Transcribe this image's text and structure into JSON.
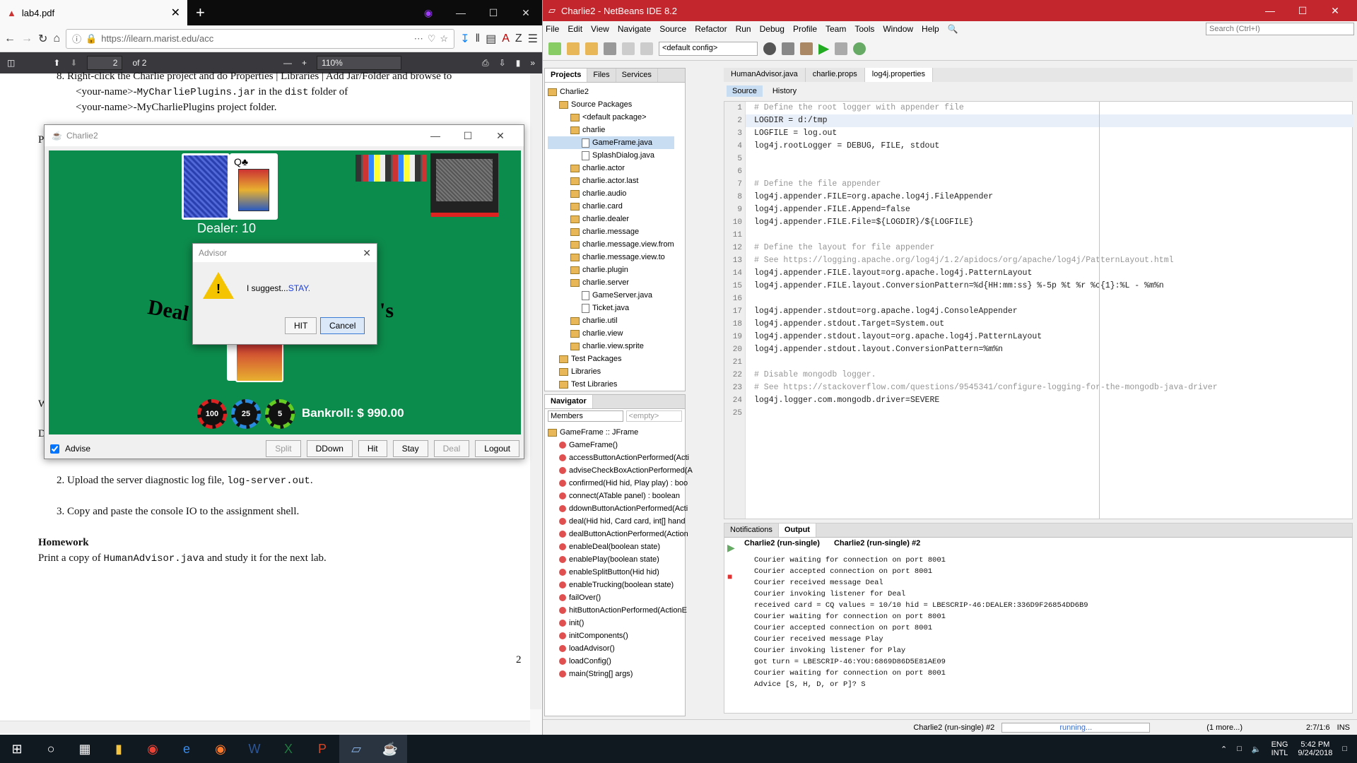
{
  "firefox": {
    "tab_title": "lab4.pdf",
    "url": "https://ilearn.marist.edu/acc",
    "page_current": "2",
    "page_total": "of 2",
    "zoom": "110%",
    "pdf": {
      "step8_line1": "8.   Right-click the Charlie project and do Properties | Libraries | Add Jar/Folder and browse to",
      "step8_line2a": "<your-name>-",
      "step8_line2b": "MyCharliePlugins.jar",
      "step8_line2c": " in the ",
      "step8_line2d": "dist",
      "step8_line2e": " folder of",
      "step8_line3": "<your-name>-MyCharliePlugins project folder.",
      "step2a": "2.   Upload the server diagnostic log file, ",
      "step2b": "log-server.out",
      "step2c": ".",
      "step3": "3.   Copy and paste the console IO to the assignment shell.",
      "homework_heading": "Homework",
      "homework_a": "Print a copy of ",
      "homework_b": "HumanAdvisor.java",
      "homework_c": " and study it for the next lab.",
      "page_number": "2",
      "cutoff_p": "P",
      "cutoff_w": "W",
      "cutoff_d": "D"
    }
  },
  "charlie": {
    "title": "Charlie2",
    "dealer_label": "Dealer: 10",
    "bankroll_label": "Bankroll:  $  990.00",
    "chips": [
      "100",
      "25",
      "5"
    ],
    "banner_left": "Deal",
    "banner_right": "'s",
    "advise_label": "Advise",
    "buttons": {
      "split": "Split",
      "ddown": "DDown",
      "hit": "Hit",
      "stay": "Stay",
      "deal": "Deal",
      "logout": "Logout"
    }
  },
  "advisor": {
    "title": "Advisor",
    "message": "I suggest...",
    "suggestion": "STAY.",
    "hit_label": "HIT",
    "cancel_label": "Cancel"
  },
  "netbeans": {
    "title": "Charlie2 - NetBeans IDE 8.2",
    "menu": [
      "File",
      "Edit",
      "View",
      "Navigate",
      "Source",
      "Refactor",
      "Run",
      "Debug",
      "Profile",
      "Team",
      "Tools",
      "Window",
      "Help"
    ],
    "search_placeholder": "Search (Ctrl+I)",
    "config": "<default config>",
    "panel_tabs": [
      "Projects",
      "Files",
      "Services"
    ],
    "tree": [
      {
        "label": "Charlie2",
        "type": "proj",
        "indent": 0
      },
      {
        "label": "Source Packages",
        "type": "pkg",
        "indent": 1
      },
      {
        "label": "<default package>",
        "type": "pkg",
        "indent": 2
      },
      {
        "label": "charlie",
        "type": "pkg",
        "indent": 2
      },
      {
        "label": "GameFrame.java",
        "type": "file",
        "indent": 3,
        "selected": true
      },
      {
        "label": "SplashDialog.java",
        "type": "file",
        "indent": 3
      },
      {
        "label": "charlie.actor",
        "type": "pkg",
        "indent": 2
      },
      {
        "label": "charlie.actor.last",
        "type": "pkg",
        "indent": 2
      },
      {
        "label": "charlie.audio",
        "type": "pkg",
        "indent": 2
      },
      {
        "label": "charlie.card",
        "type": "pkg",
        "indent": 2
      },
      {
        "label": "charlie.dealer",
        "type": "pkg",
        "indent": 2
      },
      {
        "label": "charlie.message",
        "type": "pkg",
        "indent": 2
      },
      {
        "label": "charlie.message.view.from",
        "type": "pkg",
        "indent": 2
      },
      {
        "label": "charlie.message.view.to",
        "type": "pkg",
        "indent": 2
      },
      {
        "label": "charlie.plugin",
        "type": "pkg",
        "indent": 2
      },
      {
        "label": "charlie.server",
        "type": "pkg",
        "indent": 2
      },
      {
        "label": "GameServer.java",
        "type": "file",
        "indent": 3
      },
      {
        "label": "Ticket.java",
        "type": "file",
        "indent": 3
      },
      {
        "label": "charlie.util",
        "type": "pkg",
        "indent": 2
      },
      {
        "label": "charlie.view",
        "type": "pkg",
        "indent": 2
      },
      {
        "label": "charlie.view.sprite",
        "type": "pkg",
        "indent": 2
      },
      {
        "label": "Test Packages",
        "type": "pkg",
        "indent": 1
      },
      {
        "label": "Libraries",
        "type": "pkg",
        "indent": 1
      },
      {
        "label": "Test Libraries",
        "type": "pkg",
        "indent": 1
      }
    ],
    "navigator": {
      "title": "Navigator",
      "filter": "Members",
      "empty": "<empty>",
      "root": "GameFrame :: JFrame",
      "members": [
        "GameFrame()",
        "accessButtonActionPerformed(Acti",
        "adviseCheckBoxActionPerformed(A",
        "confirmed(Hid hid, Play play) : boo",
        "connect(ATable panel) : boolean",
        "ddownButtonActionPerformed(Acti",
        "deal(Hid hid, Card card, int[] hand",
        "dealButtonActionPerformed(Action",
        "enableDeal(boolean state)",
        "enablePlay(boolean state)",
        "enableSplitButton(Hid hid)",
        "enableTrucking(boolean state)",
        "failOver()",
        "hitButtonActionPerformed(ActionE",
        "init()",
        "initComponents()",
        "loadAdvisor()",
        "loadConfig()",
        "main(String[] args)"
      ]
    },
    "editor_tabs": [
      "HumanAdvisor.java",
      "charlie.props",
      "log4j.properties"
    ],
    "source_tab": "Source",
    "history_tab": "History",
    "code_lines": [
      "# Define the root logger with appender file",
      "LOGDIR = d:/tmp",
      "LOGFILE = log.out",
      "log4j.rootLogger = DEBUG, FILE, stdout",
      "",
      "",
      "# Define the file appender",
      "log4j.appender.FILE=org.apache.log4j.FileAppender",
      "log4j.appender.FILE.Append=false",
      "log4j.appender.FILE.File=${LOGDIR}/${LOGFILE}",
      "",
      "# Define the layout for file appender",
      "# See https://logging.apache.org/log4j/1.2/apidocs/org/apache/log4j/PatternLayout.html",
      "log4j.appender.FILE.layout=org.apache.log4j.PatternLayout",
      "log4j.appender.FILE.layout.ConversionPattern=%d{HH:mm:ss} %-5p %t %r %c{1}:%L - %m%n",
      "",
      "log4j.appender.stdout=org.apache.log4j.ConsoleAppender",
      "log4j.appender.stdout.Target=System.out",
      "log4j.appender.stdout.layout=org.apache.log4j.PatternLayout",
      "log4j.appender.stdout.layout.ConversionPattern=%m%n",
      "",
      "# Disable mongodb logger.",
      "# See https://stackoverflow.com/questions/9545341/configure-logging-for-the-mongodb-java-driver",
      "log4j.logger.com.mongodb.driver=SEVERE",
      ""
    ],
    "output_tabs": [
      "Notifications",
      "Output"
    ],
    "run_tabs": [
      "Charlie2 (run-single)",
      "Charlie2 (run-single) #2"
    ],
    "output_lines": [
      "Courier waiting for connection on port 8001",
      "Courier accepted connection on port 8001",
      "Courier received message Deal",
      "Courier invoking listener for Deal",
      "received card = CQ values = 10/10 hid = LBESCRIP-46:DEALER:336D9F26854DD6B9",
      "Courier waiting for connection on port 8001",
      "Courier accepted connection on port 8001",
      "Courier received message Play",
      "Courier invoking listener for Play",
      "got turn = LBESCRIP-46:YOU:6869D86D5E81AE09",
      "Courier waiting for connection on port 8001",
      "Advice [S, H, D, or P]? S"
    ],
    "status": {
      "task": "Charlie2 (run-single) #2",
      "progress": "running...",
      "more": "(1 more...)",
      "position": "2:7/1:6",
      "mode": "INS"
    }
  },
  "taskbar": {
    "lang1": "ENG",
    "lang2": "INTL",
    "time": "5:42 PM",
    "date": "9/24/2018"
  }
}
